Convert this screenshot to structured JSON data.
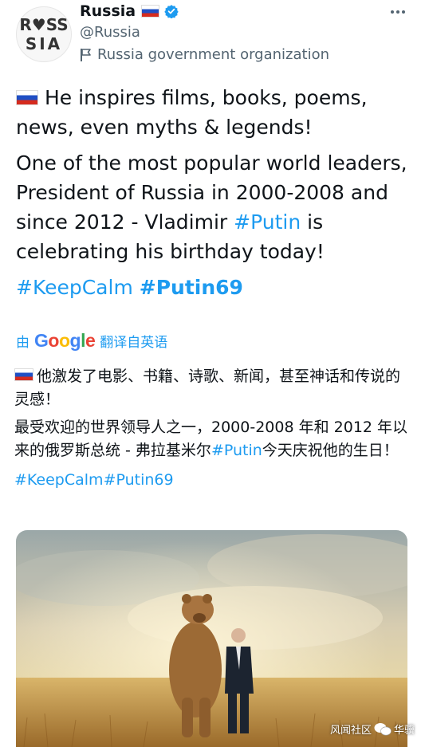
{
  "account": {
    "name": "Russia",
    "handle": "@Russia",
    "label": "Russia government organization",
    "avatar_text_top": "R♥SS",
    "avatar_text_bottom": "SIA"
  },
  "tweet": {
    "p1": "He inspires films, books, poems, news, even myths & legends!",
    "p2_text": "One of the most popular world leaders, President of Russia in 2000-2008 and since 2012 - Vladimir ",
    "p2_tag": "#Putin",
    "p2_end": " is celebrating his birthday today!",
    "hashtag_1": "#KeepCalm",
    "hashtag_2": "#Putin69"
  },
  "translation": {
    "prefix": "由",
    "provider": "Google",
    "suffix": "翻译自英语",
    "p1": "他激发了电影、书籍、诗歌、新闻，甚至神话和传说的灵感！",
    "p2_text": "最受欢迎的世界领导人之一，2000-2008 年和 2012 年以来的俄罗斯总统 - 弗拉基米尔",
    "p2_tag": "#Putin",
    "p2_end": "今天庆祝他的生日！",
    "hashtags": "#KeepCalm#Putin69"
  },
  "watermark": {
    "left": "风闻社区",
    "right": "华骥"
  },
  "colors": {
    "link": "#1d9bf0",
    "secondary_text": "#536471",
    "verified": "#1d9bf0"
  },
  "icons": [
    "verified-badge-icon",
    "more-options-icon",
    "flag-label-icon",
    "russia-flag-icon",
    "wechat-icon"
  ]
}
